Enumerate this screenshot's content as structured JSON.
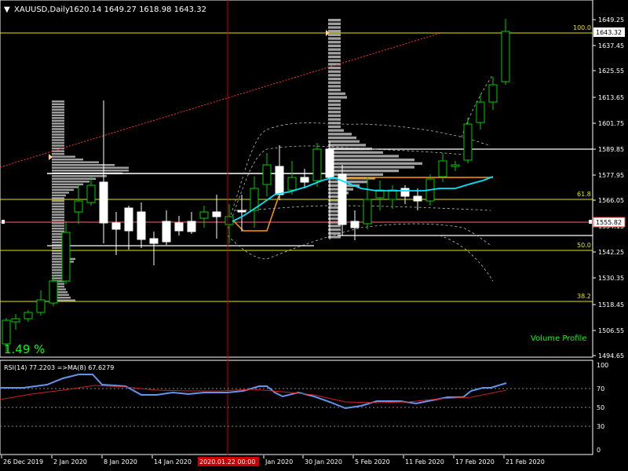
{
  "header": {
    "menu_arrow": "▼",
    "symbol": "XAUUSD,Daily",
    "ohlc": "1620.14 1649.27 1618.98 1643.32"
  },
  "price_axis": {
    "ticks": [
      "1649.25",
      "1637.45",
      "1625.55",
      "1613.65",
      "1601.75",
      "1589.85",
      "1577.95",
      "1566.05",
      "1554.15",
      "1542.25",
      "1530.35",
      "1518.45",
      "1506.55",
      "1494.65"
    ],
    "current_price": "1643.32",
    "marked_price": "1555.82"
  },
  "fib_labels": [
    "100.0",
    "61.8",
    "50.0",
    "38.2"
  ],
  "overlay": {
    "percent": "1.49 %",
    "volume_profile_label": "Volume Profile"
  },
  "rsi": {
    "title": "RSI(14) 77.2203  =>MA(8) 67.6279",
    "ticks": [
      "100",
      "70",
      "50",
      "30",
      "0"
    ]
  },
  "time_axis": {
    "labels": [
      "26 Dec 2019",
      "2 Jan 2020",
      "8 Jan 2020",
      "14 Jan 2020",
      "Jan 2020",
      "30 Jan 2020",
      "5 Feb 2020",
      "11 Feb 2020",
      "17 Feb 2020",
      "21 Feb 2020"
    ],
    "crosshair_time": "2020.01.22 00:00"
  },
  "colors": {
    "background": "#000000",
    "grid": "#ffffff",
    "bull_candle": "#00cc00",
    "bear_candle": "#ffffff",
    "crosshair": "#cc0000",
    "fib": "#e6e600",
    "ma": "#00e5ff",
    "rsi_line": "#6495ed",
    "rsi_ma": "#cc2222",
    "volume_label": "#00ff00",
    "percent": "#00ff00",
    "price_marker": "#ff4444",
    "orange_line": "#ff9900"
  }
}
